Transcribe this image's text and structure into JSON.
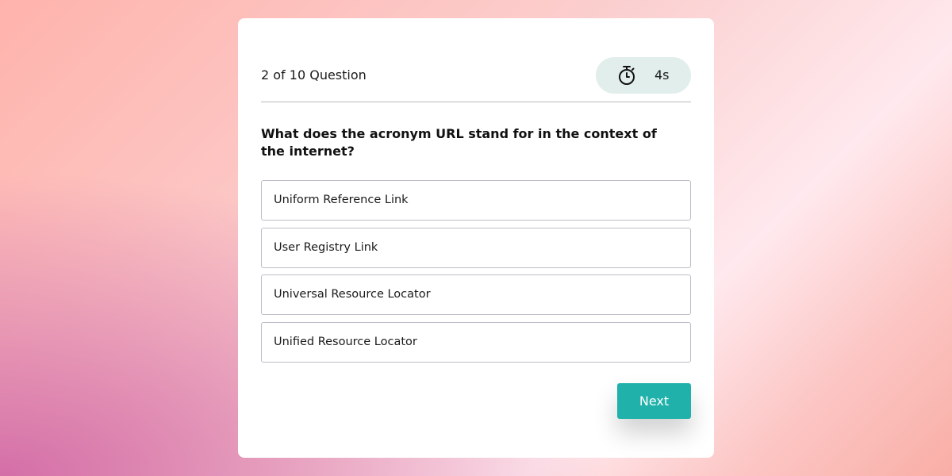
{
  "quiz": {
    "counter_text": "2 of 10 Question",
    "timer": {
      "icon": "stopwatch-icon",
      "value": "4s"
    },
    "question": "What does the acronym URL stand for in the context of the internet?",
    "options": [
      {
        "label": "Uniform Reference Link"
      },
      {
        "label": "User Registry Link"
      },
      {
        "label": "Universal Resource Locator"
      },
      {
        "label": "Unified Resource Locator"
      }
    ],
    "next_label": "Next"
  },
  "colors": {
    "accent": "#20b2aa",
    "timer_bg": "#e2eeec",
    "card_bg": "#ffffff"
  }
}
